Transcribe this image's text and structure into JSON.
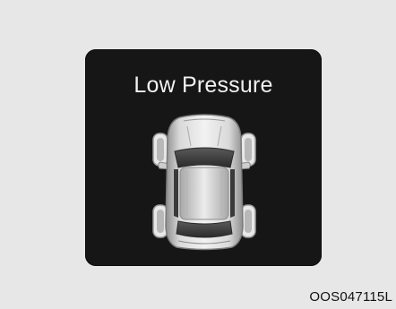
{
  "warning": {
    "title": "Low Pressure",
    "icon": "car-top-view-tire-pressure-icon"
  },
  "figure_code": "OOS047115L",
  "colors": {
    "background": "#e7e7e7",
    "panel": "#161616",
    "text": "#f1f1f1",
    "car_body": "#d0d0d0"
  }
}
